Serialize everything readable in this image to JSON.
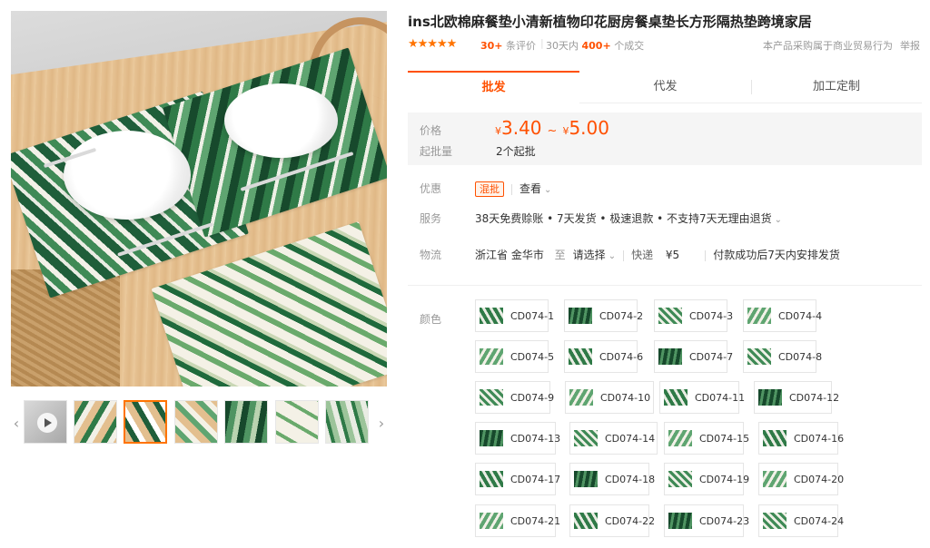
{
  "title": "ins北欧棉麻餐垫小清新植物印花厨房餐桌垫长方形隔热垫跨境家居",
  "rating": {
    "stars": "★★★★★",
    "review_count": "30+",
    "review_suffix": "条评价",
    "sales_prefix": "30天内",
    "sales_count": "400+",
    "sales_suffix": "个成交"
  },
  "business_note": "本产品采购属于商业贸易行为",
  "report_label": "举报",
  "tabs": [
    "批发",
    "代发",
    "加工定制"
  ],
  "price": {
    "label": "价格",
    "currency": "¥",
    "min": "3.40",
    "max": "5.00",
    "separator": "~",
    "moq_label": "起批量",
    "moq_value": "2个起批"
  },
  "promo": {
    "label": "优惠",
    "badge": "混批",
    "view": "查看"
  },
  "service": {
    "label": "服务",
    "text": "38天免费赊账 • 7天发货 • 极速退款 • 不支持7天无理由退货"
  },
  "logistics": {
    "label": "物流",
    "origin": "浙江省 金华市",
    "to": "至",
    "dest": "请选择",
    "method": "快递",
    "fee": "¥5",
    "note": "付款成功后7天内安排发货"
  },
  "color_label": "颜色",
  "skus": [
    "CD074-1",
    "CD074-2",
    "CD074-3",
    "CD074-4",
    "CD074-5",
    "CD074-6",
    "CD074-7",
    "CD074-8",
    "CD074-9",
    "CD074-10",
    "CD074-11",
    "CD074-12",
    "CD074-13",
    "CD074-14",
    "CD074-15",
    "CD074-16",
    "CD074-17",
    "CD074-18",
    "CD074-19",
    "CD074-20",
    "CD074-21",
    "CD074-22",
    "CD074-23",
    "CD074-24"
  ],
  "colors": {
    "accent": "#ff5000",
    "star": "#ff7300",
    "price_bg": "#f5f5f5"
  }
}
